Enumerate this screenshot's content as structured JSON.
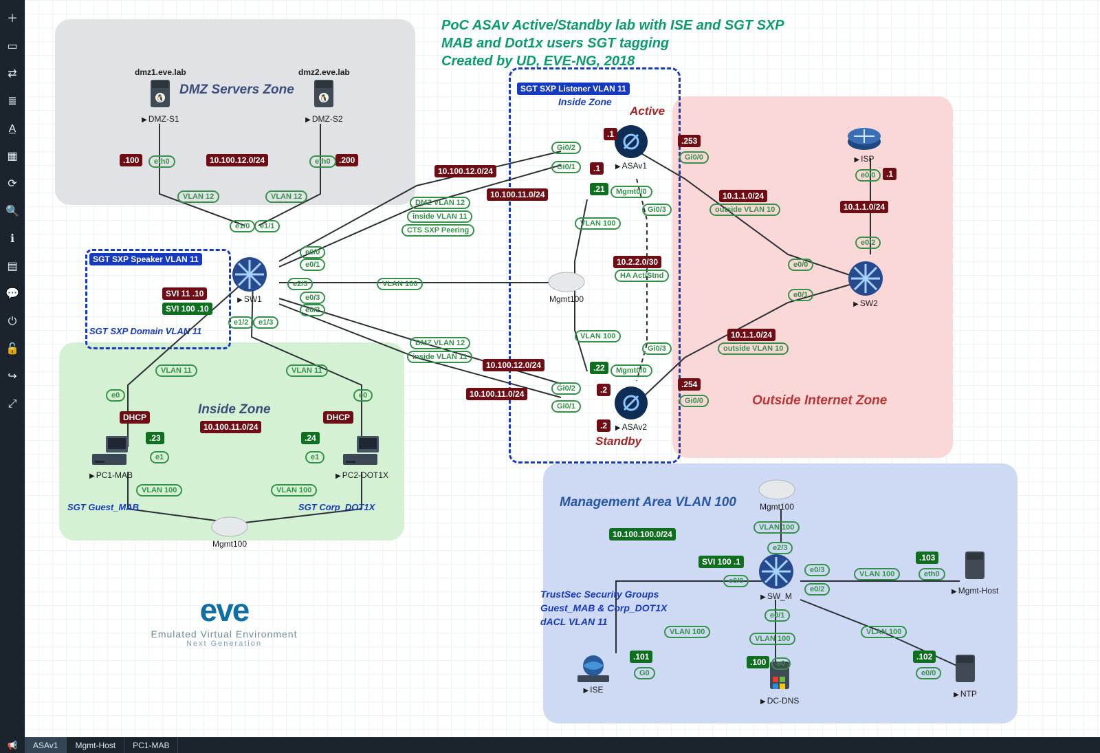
{
  "header": {
    "line1": "PoC ASAv  Active/Standby lab with ISE and SGT SXP",
    "line2": "MAB and Dot1x users SGT tagging",
    "line3": "Created by UD, EVE-NG, 2018"
  },
  "toolbar": {
    "items": [
      "plus-icon",
      "node-icon",
      "swap-icon",
      "list-icon",
      "text-icon",
      "grid-icon",
      "refresh-icon",
      "search-icon",
      "info-icon",
      "clipboard-icon",
      "chat-icon",
      "power-icon",
      "lock-icon",
      "exit-icon",
      "expand-icon"
    ]
  },
  "zones": {
    "dmz": "DMZ Servers Zone",
    "inside": "Inside Zone",
    "outside": "Outside Internet Zone",
    "mgmt": "Management Area VLAN 100",
    "asa_inside": "Inside Zone",
    "sxp_listener": "SGT SXP Listener VLAN 11",
    "sxp_speaker": "SGT SXP Speaker VLAN 11",
    "sxp_domain": "SGT SXP Domain VLAN 11",
    "active": "Active",
    "standby": "Standby"
  },
  "nodes": {
    "dmz1": {
      "host": "dmz1.eve.lab",
      "name": "DMZ-S1"
    },
    "dmz2": {
      "host": "dmz2.eve.lab",
      "name": "DMZ-S2"
    },
    "sw1": "SW1",
    "sw2": "SW2",
    "swm": "SW_M",
    "asa1": "ASAv1",
    "asa2": "ASAv2",
    "pc1": "PC1-MAB",
    "pc2": "PC2-DOT1X",
    "ise": "ISE",
    "ntp": "NTP",
    "dcdns": "DC-DNS",
    "mgmthost": "Mgmt-Host",
    "isp": "ISP",
    "mgmt100": "Mgmt100"
  },
  "nets": {
    "dmz": "10.100.12.0/24",
    "inside": "10.100.11.0/24",
    "outside": "10.1.1.0/24",
    "ha": "10.2.2.0/30",
    "mgmt": "10.100.100.0/24",
    "dmz_ip1": ".100",
    "dmz_ip2": ".200",
    "asa1_ip": ".1",
    "asa2_ip": ".2",
    "fw_out1": ".253",
    "fw_out2": ".254",
    "isp_ip": ".1",
    "mab_ip": ".23",
    "dot1x_ip": ".24",
    "mgmt21": ".21",
    "mgmt22": ".22",
    "ise_ip": ".101",
    "ntp_ip": ".102",
    "dcdns_ip": ".100",
    "mhost_ip": ".103"
  },
  "labels": {
    "vlan11": "VLAN 11",
    "vlan12": "VLAN 12",
    "vlan100": "VLAN 100",
    "dmzvlan": "DMZ VLAN 12",
    "insidevlan": "inside VLAN 11",
    "cts": "CTS SXP Peering",
    "dhcp": "DHCP",
    "svi11": "SVI 11  .10",
    "svi100": "SVI 100 .10",
    "svi100_1": "SVI 100 .1",
    "outvlan": "outside VLAN 10",
    "haact": "HA Act/Stnd",
    "guest": "SGT Guest_MAB",
    "corp": "SGT Corp_DOT1X",
    "trustsec1": "TrustSec Security Groups",
    "trustsec2": "Guest_MAB  & Corp_DOT1X",
    "trustsec3": "dACL VLAN 11",
    "eth0": "eth0",
    "e0": "e0",
    "e1": "e1",
    "e0_0": "e0/0",
    "e0_1": "e0/1",
    "e0_2": "e0/2",
    "e0_3": "e0/3",
    "e1_0": "e1/0",
    "e1_1": "e1/1",
    "e1_2": "e1/2",
    "e1_3": "e1/3",
    "e2_3": "e2/3",
    "gi00": "Gi0/0",
    "gi01": "Gi0/1",
    "gi02": "Gi0/2",
    "gi03": "Gi0/3",
    "mgmt00": "Mgmt0/0",
    "g0": "G0"
  },
  "logo": {
    "brand": "eve",
    "sub1": "Emulated Virtual Environment",
    "sub2": "Next Generation"
  },
  "bottombar": {
    "tabs": [
      "ASAv1",
      "Mgmt-Host",
      "PC1-MAB"
    ]
  }
}
